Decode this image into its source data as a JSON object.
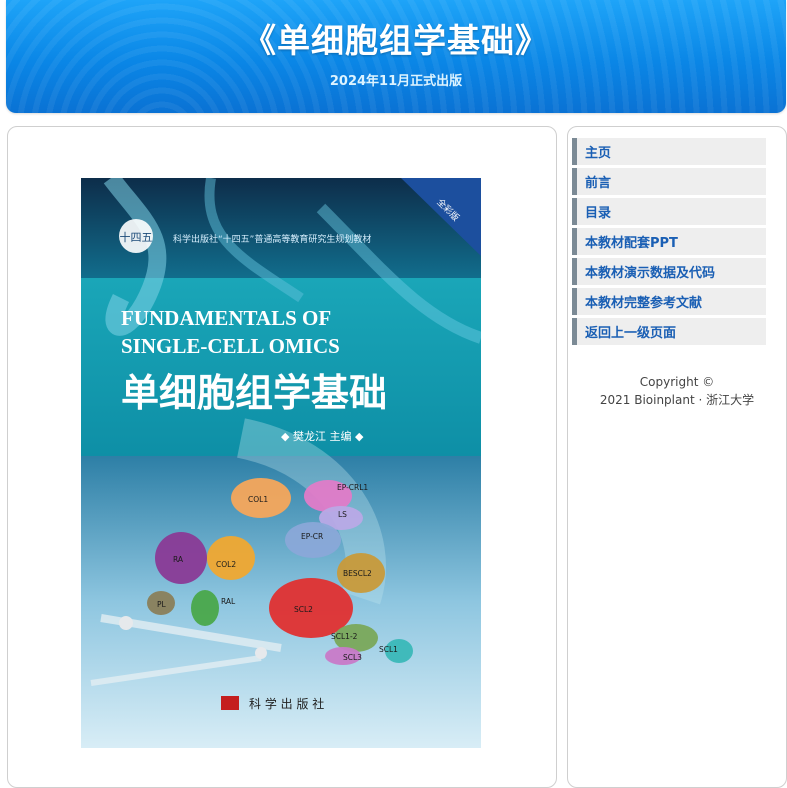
{
  "header": {
    "title": "《单细胞组学基础》",
    "subtitle": "2024年11月正式出版"
  },
  "book_cover": {
    "publisher_line": "科学出版社“十四五”普通高等教育研究生规划教材",
    "edition_badge": "全彩版",
    "english_title_line1": "FUNDAMENTALS OF",
    "english_title_line2": "SINGLE-CELL OMICS",
    "chinese_title": "单细胞组学基础",
    "editor_line": "◆ 樊龙江 主编 ◆",
    "publisher_name": "科 学 出 版 社",
    "cluster_labels": [
      "COL1",
      "EP-CRL1",
      "LS",
      "EP-CR",
      "RA",
      "COL2",
      "BESCL2",
      "PL",
      "RAL",
      "SCL2",
      "SCL1-2",
      "SCL1",
      "SCL3"
    ]
  },
  "sidebar": {
    "items": [
      {
        "label": "主页"
      },
      {
        "label": "前言"
      },
      {
        "label": "目录"
      },
      {
        "label": "本教材配套PPT"
      },
      {
        "label": "本教材演示数据及代码"
      },
      {
        "label": "本教材完整参考文献"
      },
      {
        "label": "返回上一级页面"
      }
    ],
    "copyright_line1": "Copyright ©",
    "copyright_line2": "2021 Bioinplant · 浙江大学"
  }
}
